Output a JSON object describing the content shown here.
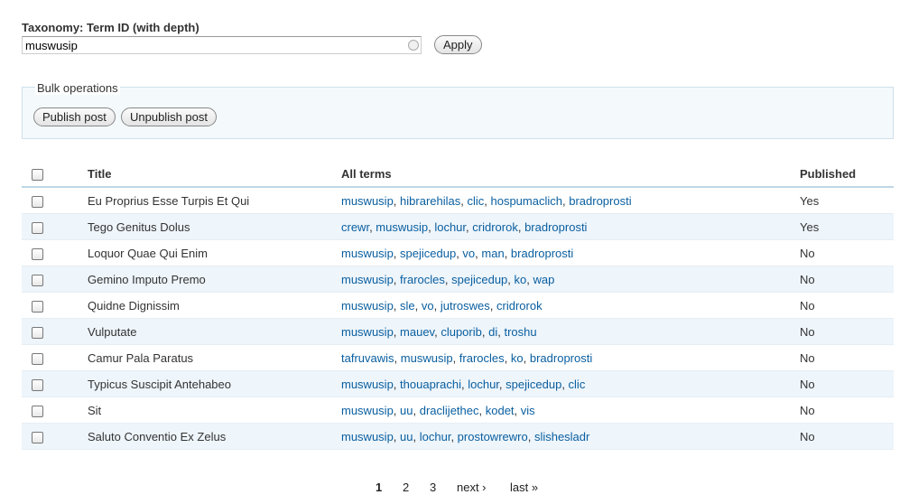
{
  "filter": {
    "label": "Taxonomy: Term ID (with depth)",
    "value": "muswusip",
    "apply_label": "Apply"
  },
  "bulk": {
    "legend": "Bulk operations",
    "publish_label": "Publish post",
    "unpublish_label": "Unpublish post"
  },
  "table": {
    "headers": {
      "title": "Title",
      "terms": "All terms",
      "published": "Published"
    },
    "rows": [
      {
        "title": "Eu Proprius Esse Turpis Et Qui",
        "terms": [
          "muswusip",
          "hibrarehilas",
          "clic",
          "hospumaclich",
          "bradroprosti"
        ],
        "published": "Yes"
      },
      {
        "title": "Tego Genitus Dolus",
        "terms": [
          "crewr",
          "muswusip",
          "lochur",
          "cridrorok",
          "bradroprosti"
        ],
        "published": "Yes"
      },
      {
        "title": "Loquor Quae Qui Enim",
        "terms": [
          "muswusip",
          "spejicedup",
          "vo",
          "man",
          "bradroprosti"
        ],
        "published": "No"
      },
      {
        "title": "Gemino Imputo Premo",
        "terms": [
          "muswusip",
          "frarocles",
          "spejicedup",
          "ko",
          "wap"
        ],
        "published": "No"
      },
      {
        "title": "Quidne Dignissim",
        "terms": [
          "muswusip",
          "sle",
          "vo",
          "jutroswes",
          "cridrorok"
        ],
        "published": "No"
      },
      {
        "title": "Vulputate",
        "terms": [
          "muswusip",
          "mauev",
          "cluporib",
          "di",
          "troshu"
        ],
        "published": "No"
      },
      {
        "title": "Camur Pala Paratus",
        "terms": [
          "tafruvawis",
          "muswusip",
          "frarocles",
          "ko",
          "bradroprosti"
        ],
        "published": "No"
      },
      {
        "title": "Typicus Suscipit Antehabeo",
        "terms": [
          "muswusip",
          "thouaprachi",
          "lochur",
          "spejicedup",
          "clic"
        ],
        "published": "No"
      },
      {
        "title": "Sit",
        "terms": [
          "muswusip",
          "uu",
          "draclijethec",
          "kodet",
          "vis"
        ],
        "published": "No"
      },
      {
        "title": "Saluto Conventio Ex Zelus",
        "terms": [
          "muswusip",
          "uu",
          "lochur",
          "prostowrewro",
          "slishesladr"
        ],
        "published": "No"
      }
    ]
  },
  "pager": {
    "current": "1",
    "page2": "2",
    "page3": "3",
    "next": "next ›",
    "last": "last »"
  },
  "colors": {
    "link": "#0a5fa0",
    "row_alt": "#eef5fb",
    "header_rule": "#bfd7e6"
  }
}
